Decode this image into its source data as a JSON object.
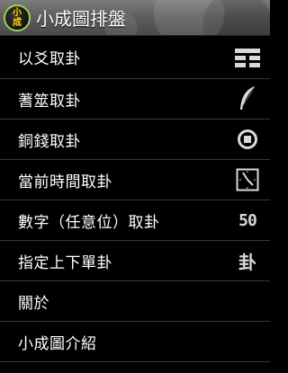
{
  "header": {
    "logo_top": "小",
    "logo_bottom": "成",
    "title": "小成圖排盤",
    "accent": "#9bd34d"
  },
  "menu": {
    "items": [
      {
        "label": "以爻取卦",
        "icon": "trigram-lines-icon"
      },
      {
        "label": "蓍筮取卦",
        "icon": "feather-icon"
      },
      {
        "label": "銅錢取卦",
        "icon": "coin-icon"
      },
      {
        "label": "當前時間取卦",
        "icon": "clock-icon"
      },
      {
        "label": "數字（任意位）取卦",
        "icon": "number-icon",
        "icon_text": "50"
      },
      {
        "label": "指定上下單卦",
        "icon": "hexagram-char-icon",
        "icon_text": "卦"
      },
      {
        "label": "關於"
      },
      {
        "label": "小成圖介紹"
      }
    ]
  }
}
